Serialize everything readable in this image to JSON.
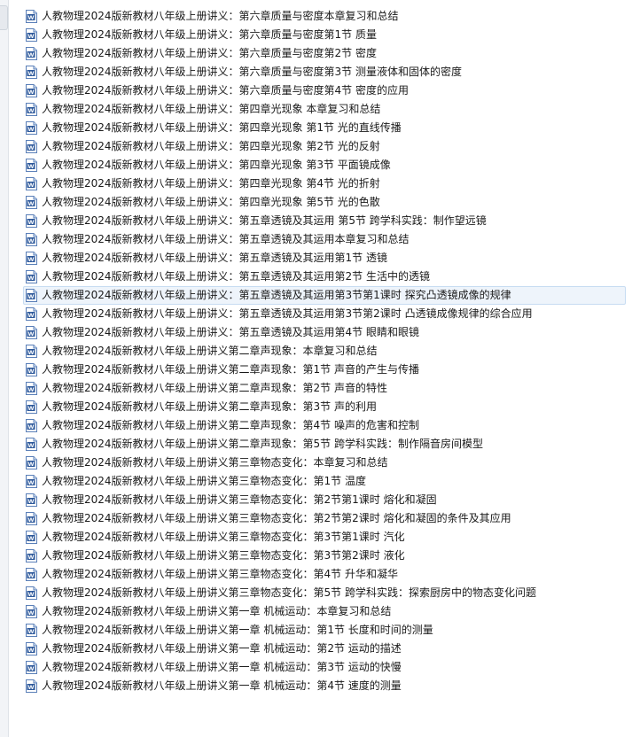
{
  "files": [
    {
      "name": "人教物理2024版新教材八年级上册讲义：第六章质量与密度本章复习和总结",
      "icon": "word-doc-icon"
    },
    {
      "name": "人教物理2024版新教材八年级上册讲义：第六章质量与密度第1节 质量",
      "icon": "word-doc-icon"
    },
    {
      "name": "人教物理2024版新教材八年级上册讲义：第六章质量与密度第2节 密度",
      "icon": "word-doc-icon"
    },
    {
      "name": "人教物理2024版新教材八年级上册讲义：第六章质量与密度第3节 测量液体和固体的密度",
      "icon": "word-doc-icon"
    },
    {
      "name": "人教物理2024版新教材八年级上册讲义：第六章质量与密度第4节 密度的应用",
      "icon": "word-doc-icon"
    },
    {
      "name": "人教物理2024版新教材八年级上册讲义：第四章光现象 本章复习和总结",
      "icon": "word-doc-icon"
    },
    {
      "name": "人教物理2024版新教材八年级上册讲义：第四章光现象 第1节 光的直线传播",
      "icon": "word-doc-icon"
    },
    {
      "name": "人教物理2024版新教材八年级上册讲义：第四章光现象 第2节 光的反射",
      "icon": "word-doc-icon"
    },
    {
      "name": "人教物理2024版新教材八年级上册讲义：第四章光现象 第3节 平面镜成像",
      "icon": "word-doc-icon"
    },
    {
      "name": "人教物理2024版新教材八年级上册讲义：第四章光现象 第4节 光的折射",
      "icon": "word-doc-icon"
    },
    {
      "name": "人教物理2024版新教材八年级上册讲义：第四章光现象 第5节 光的色散",
      "icon": "word-doc-icon"
    },
    {
      "name": "人教物理2024版新教材八年级上册讲义：第五章透镜及其运用 第5节 跨学科实践：制作望远镜",
      "icon": "word-doc-icon"
    },
    {
      "name": "人教物理2024版新教材八年级上册讲义：第五章透镜及其运用本章复习和总结",
      "icon": "word-doc-icon"
    },
    {
      "name": "人教物理2024版新教材八年级上册讲义：第五章透镜及其运用第1节 透镜",
      "icon": "word-doc-icon"
    },
    {
      "name": "人教物理2024版新教材八年级上册讲义：第五章透镜及其运用第2节 生活中的透镜",
      "icon": "word-doc-icon"
    },
    {
      "name": "人教物理2024版新教材八年级上册讲义：第五章透镜及其运用第3节第1课时 探究凸透镜成像的规律",
      "icon": "word-doc-icon",
      "selected": true
    },
    {
      "name": "人教物理2024版新教材八年级上册讲义：第五章透镜及其运用第3节第2课时 凸透镜成像规律的综合应用",
      "icon": "word-doc-icon"
    },
    {
      "name": "人教物理2024版新教材八年级上册讲义：第五章透镜及其运用第4节 眼睛和眼镜",
      "icon": "word-doc-icon"
    },
    {
      "name": "人教物理2024版新教材八年级上册讲义第二章声现象：本章复习和总结",
      "icon": "word-doc-icon"
    },
    {
      "name": "人教物理2024版新教材八年级上册讲义第二章声现象：第1节 声音的产生与传播",
      "icon": "word-doc-icon"
    },
    {
      "name": "人教物理2024版新教材八年级上册讲义第二章声现象：第2节 声音的特性",
      "icon": "word-doc-icon"
    },
    {
      "name": "人教物理2024版新教材八年级上册讲义第二章声现象：第3节 声的利用",
      "icon": "word-doc-icon"
    },
    {
      "name": "人教物理2024版新教材八年级上册讲义第二章声现象：第4节 噪声的危害和控制",
      "icon": "word-doc-icon"
    },
    {
      "name": "人教物理2024版新教材八年级上册讲义第二章声现象：第5节 跨学科实践：制作隔音房间模型",
      "icon": "word-doc-icon"
    },
    {
      "name": "人教物理2024版新教材八年级上册讲义第三章物态变化：本章复习和总结",
      "icon": "word-doc-icon"
    },
    {
      "name": "人教物理2024版新教材八年级上册讲义第三章物态变化：第1节 温度",
      "icon": "word-doc-icon"
    },
    {
      "name": "人教物理2024版新教材八年级上册讲义第三章物态变化：第2节第1课时 熔化和凝固",
      "icon": "word-doc-icon"
    },
    {
      "name": "人教物理2024版新教材八年级上册讲义第三章物态变化：第2节第2课时 熔化和凝固的条件及其应用",
      "icon": "word-doc-icon"
    },
    {
      "name": "人教物理2024版新教材八年级上册讲义第三章物态变化：第3节第1课时 汽化",
      "icon": "word-doc-icon"
    },
    {
      "name": "人教物理2024版新教材八年级上册讲义第三章物态变化：第3节第2课时 液化",
      "icon": "word-doc-icon"
    },
    {
      "name": "人教物理2024版新教材八年级上册讲义第三章物态变化：第4节 升华和凝华",
      "icon": "word-doc-icon"
    },
    {
      "name": "人教物理2024版新教材八年级上册讲义第三章物态变化：第5节 跨学科实践：探索厨房中的物态变化问题",
      "icon": "word-doc-icon"
    },
    {
      "name": "人教物理2024版新教材八年级上册讲义第一章 机械运动：本章复习和总结",
      "icon": "word-doc-icon"
    },
    {
      "name": "人教物理2024版新教材八年级上册讲义第一章 机械运动：第1节 长度和时间的测量",
      "icon": "word-doc-icon"
    },
    {
      "name": "人教物理2024版新教材八年级上册讲义第一章 机械运动：第2节 运动的描述",
      "icon": "word-doc-icon"
    },
    {
      "name": "人教物理2024版新教材八年级上册讲义第一章 机械运动：第3节 运动的快慢",
      "icon": "word-doc-icon"
    },
    {
      "name": "人教物理2024版新教材八年级上册讲义第一章 机械运动：第4节 速度的测量",
      "icon": "word-doc-icon"
    }
  ],
  "colors": {
    "icon_blue": "#2b579a",
    "icon_border": "#5a7fb8",
    "selection_bg": "#eef4fb",
    "selection_border": "#c7dcf2",
    "text": "#1a1a1a"
  }
}
